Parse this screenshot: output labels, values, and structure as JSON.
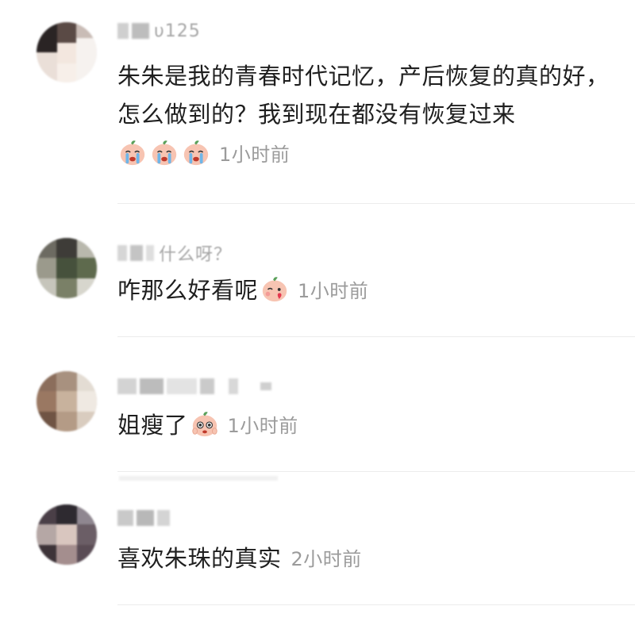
{
  "comments": [
    {
      "username_fragment": " υ125",
      "text": "朱朱是我的青春时代记忆，产后恢复的真的好，怎么做到的？我到现在都没有恢复过来",
      "time": "1小时前",
      "emojis": [
        "crying-peach-emoji",
        "crying-peach-emoji",
        "crying-peach-emoji"
      ]
    },
    {
      "username_fragment": "什么呀？",
      "text": "咋那么好看呢",
      "time": "1小时前",
      "emojis": [
        "love-peach-emoji"
      ]
    },
    {
      "username_fragment": "",
      "text": "姐瘦了",
      "time": "1小时前",
      "emojis": [
        "admiring-peach-emoji"
      ]
    },
    {
      "username_fragment": "",
      "text": "喜欢朱珠的真实",
      "time": "2小时前",
      "emojis": []
    }
  ],
  "colors": {
    "text": "#1f1f1f",
    "time": "#9b9b9b",
    "divider": "#ececec",
    "peach": "#f6b8a6",
    "leaf": "#5aa05a"
  }
}
